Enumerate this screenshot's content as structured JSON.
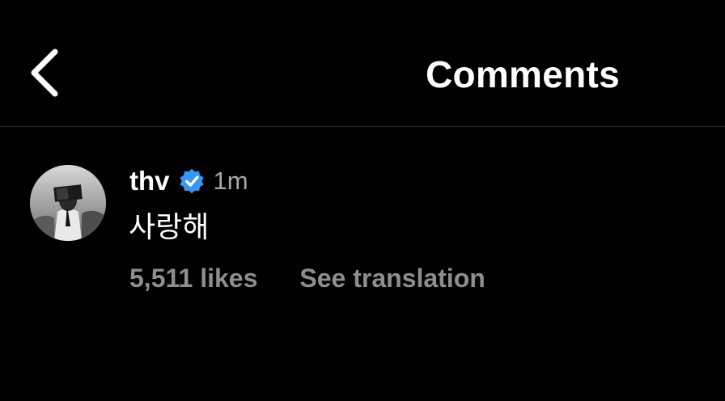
{
  "header": {
    "back_icon": "chevron-left-icon",
    "title": "Comments"
  },
  "comment": {
    "avatar_icon": "profile-photo",
    "username": "thv",
    "verified_icon": "verified-badge-icon",
    "timestamp": "1m",
    "text": "사랑해",
    "likes": "5,511 likes",
    "translate_label": "See translation"
  },
  "colors": {
    "background": "#000000",
    "primary_text": "#ffffff",
    "secondary_text": "#8e8e8e",
    "timestamp_text": "#a8a8a8",
    "verified_badge": "#3897f0",
    "divider": "#2a2a2a"
  }
}
